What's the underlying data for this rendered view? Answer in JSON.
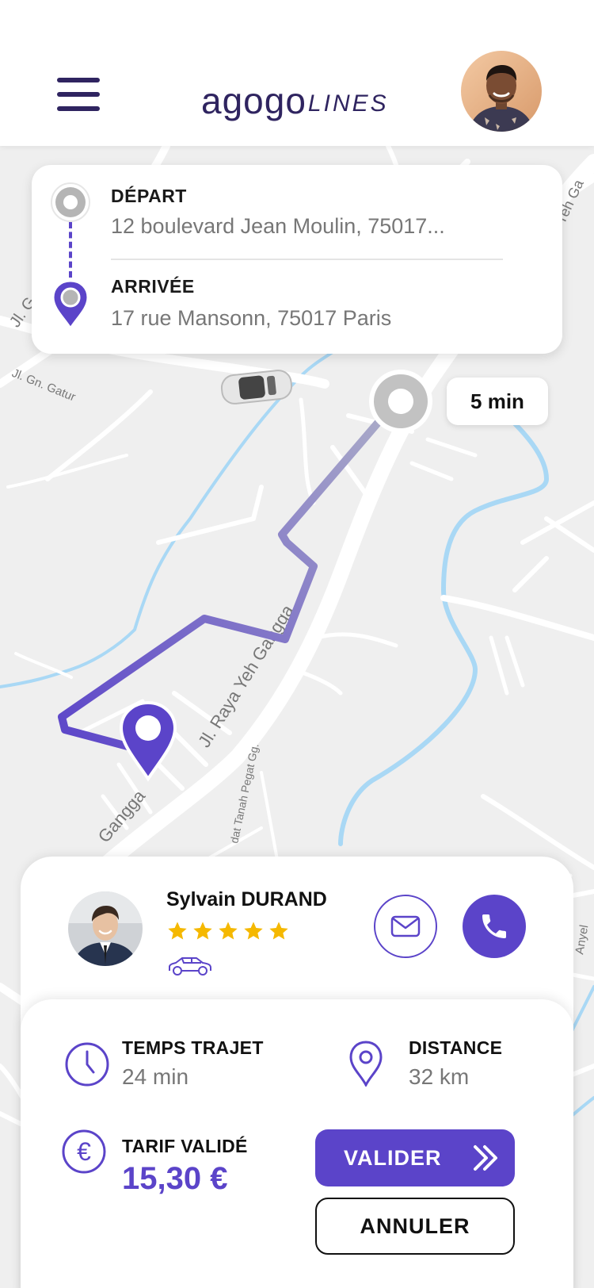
{
  "header": {
    "logo_main": "agogo",
    "logo_sub": "LINES",
    "menu_icon": "hamburger-menu-icon",
    "avatar_icon": "user-avatar"
  },
  "route": {
    "departure_label": "DÉPART",
    "departure_address": "12 boulevard Jean Moulin, 75017...",
    "arrival_label": "ARRIVÉE",
    "arrival_address": "17 rue Mansonn, 75017 Paris"
  },
  "map": {
    "eta": "5 min",
    "street_labels": [
      "Jl. Raya Yeh Gangga",
      "Jl. Gn. Gatur",
      "Gangga",
      "dat Tanah Pegat Gg.",
      "Yeh Ga",
      "Jl. G",
      "Anyel"
    ],
    "route_color_start": "#5b44c9",
    "route_color_end": "#a8a8c8",
    "water_color": "#a9d8f5"
  },
  "driver": {
    "name": "Sylvain DURAND",
    "rating": 5,
    "rating_max": 5,
    "star_color": "#f5b800",
    "vehicle_icon": "car-outline-icon",
    "mail_icon": "mail-icon",
    "phone_icon": "phone-icon"
  },
  "trip": {
    "time_label": "TEMPS TRAJET",
    "time_value": "24 min",
    "distance_label": "DISTANCE",
    "distance_value": "32 km",
    "fare_label": "TARIF VALIDÉ",
    "fare_value": "15,30 €",
    "validate_label": "VALIDER",
    "cancel_label": "ANNULER",
    "accent_color": "#5b44c9"
  }
}
